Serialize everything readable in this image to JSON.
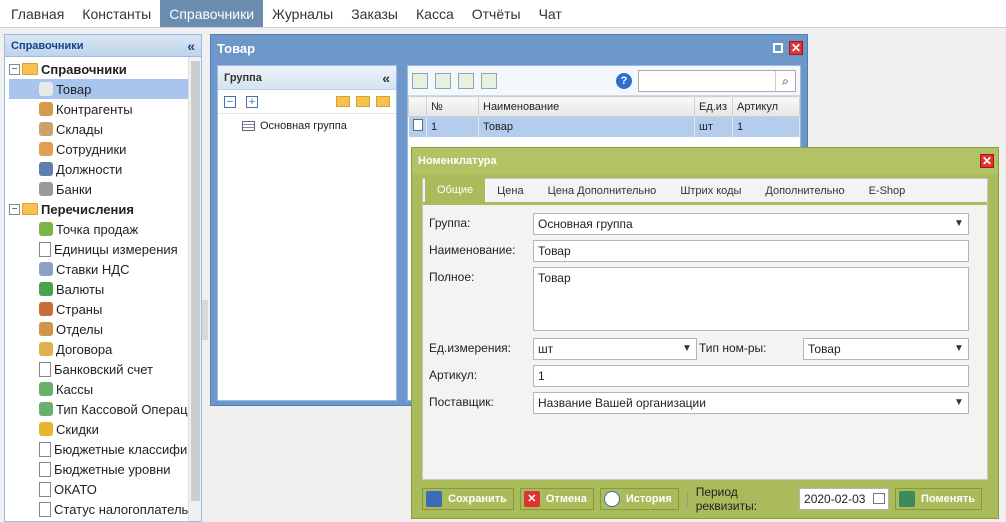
{
  "topmenu": [
    "Главная",
    "Константы",
    "Справочники",
    "Журналы",
    "Заказы",
    "Касса",
    "Отчёты",
    "Чат"
  ],
  "topmenu_active": 2,
  "sidebar": {
    "title": "Справочники",
    "collapse": "«",
    "groups": [
      {
        "label": "Справочники",
        "items": [
          "Товар",
          "Контрагенты",
          "Склады",
          "Сотрудники",
          "Должности",
          "Банки"
        ]
      },
      {
        "label": "Перечисления",
        "items": [
          "Точка продаж",
          "Единицы измерения",
          "Ставки НДС",
          "Валюты",
          "Страны",
          "Отделы",
          "Договора",
          "Банковский счет",
          "Кассы",
          "Тип Кассовой Операц",
          "Скидки",
          "Бюджетные классифи",
          "Бюджетные уровни",
          "ОКАТО",
          "Статус налогоплатель"
        ]
      }
    ]
  },
  "win_tovar": {
    "title": "Товар",
    "group_panel": {
      "title": "Группа",
      "collapse": "«",
      "row": "Основная группа",
      "minus": "−",
      "plus": "+"
    },
    "grid": {
      "help": "?",
      "search_placeholder": "",
      "columns": [
        "№",
        "Наименование",
        "Ед.из",
        "Артикул"
      ],
      "rows": [
        [
          "1",
          "Товар",
          "шт",
          "1"
        ]
      ]
    }
  },
  "dialog": {
    "title": "Номенклатура",
    "tabs": [
      "Общие",
      "Цена",
      "Цена Дополнительно",
      "Штрих коды",
      "Дополнительно",
      "E-Shop"
    ],
    "active_tab": 0,
    "fields": {
      "group_label": "Группа:",
      "group_value": "Основная группа",
      "name_label": "Наименование:",
      "name_value": "Товар",
      "full_label": "Полное:",
      "full_value": "Товар",
      "unit_label": "Ед.измерения:",
      "unit_value": "шт",
      "type_label": "Тип ном-ры:",
      "type_value": "Товар",
      "article_label": "Артикул:",
      "article_value": "1",
      "supplier_label": "Поставщик:",
      "supplier_value": "Название Вашей организации"
    },
    "footer": {
      "save": "Сохранить",
      "cancel": "Отмена",
      "history": "История",
      "period_label": "Период реквизиты:",
      "period_value": "2020-02-03",
      "change": "Поменять"
    }
  },
  "colors": {
    "accent": "#6d97c8",
    "dialog": "#a9bb5b",
    "menu_active": "#6a8cae"
  }
}
